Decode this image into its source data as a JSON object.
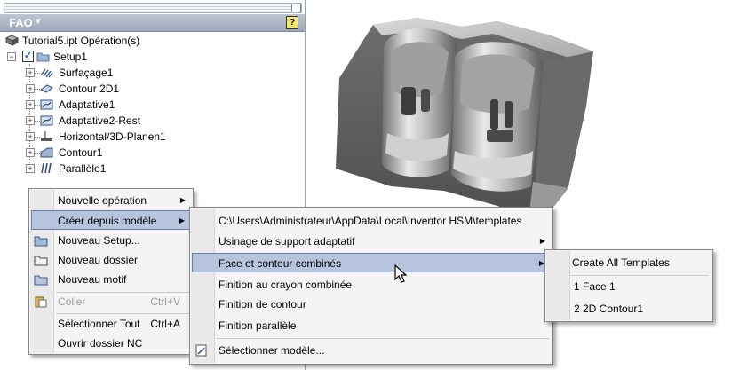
{
  "panel": {
    "title": "FAO",
    "help": "?",
    "tree": [
      {
        "label": "Tutorial5.ipt Opération(s)",
        "icon": "part-icon"
      },
      {
        "label": "Setup1",
        "icon": "setup-folder-icon"
      },
      {
        "label": "Surfaçage1",
        "icon": "facing-op-icon"
      },
      {
        "label": "Contour 2D1",
        "icon": "contour2d-op-icon"
      },
      {
        "label": "Adaptative1",
        "icon": "adaptive-op-icon"
      },
      {
        "label": "Adaptative2-Rest",
        "icon": "adaptive-op-icon"
      },
      {
        "label": "Horizontal/3D-Planen1",
        "icon": "horizontal-op-icon"
      },
      {
        "label": "Contour1",
        "icon": "contour-op-icon"
      },
      {
        "label": "Parallèle1",
        "icon": "parallel-op-icon"
      }
    ]
  },
  "context_menu": {
    "items": [
      {
        "label": "Nouvelle opération",
        "submenu": true
      },
      {
        "label": "Créer depuis modèle",
        "submenu": true,
        "selected": true
      },
      {
        "label": "Nouveau Setup...",
        "icon": "setup-icon"
      },
      {
        "label": "Nouveau dossier",
        "icon": "folder-icon"
      },
      {
        "label": "Nouveau motif",
        "icon": "pattern-icon"
      },
      {
        "label": "Coller",
        "shortcut": "Ctrl+V",
        "disabled": true,
        "icon": "paste-icon"
      },
      {
        "label": "Sélectionner Tout",
        "shortcut": "Ctrl+A"
      },
      {
        "label": "Ouvrir dossier NC"
      }
    ]
  },
  "template_menu": {
    "items": [
      {
        "label": "C:\\Users\\Administrateur\\AppData\\Local\\Inventor HSM\\templates"
      },
      {
        "label": "Usinage de support adaptatif",
        "submenu": true
      },
      {
        "label": "Face et contour combinés",
        "submenu": true,
        "selected": true
      },
      {
        "label": "Finition au crayon combinée"
      },
      {
        "label": "Finition de contour"
      },
      {
        "label": "Finition parallèle"
      },
      {
        "label": "Sélectionner modèle...",
        "icon": "select-template-icon"
      }
    ]
  },
  "sub_menu": {
    "items": [
      {
        "label": "Create All Templates"
      },
      {
        "label": "1 Face 1"
      },
      {
        "label": "2 2D Contour1"
      }
    ]
  },
  "colors": {
    "menu_highlight": "#b7c4dd",
    "header_bg": "#a7b1c1",
    "model_gray": "#8a8a8a"
  }
}
